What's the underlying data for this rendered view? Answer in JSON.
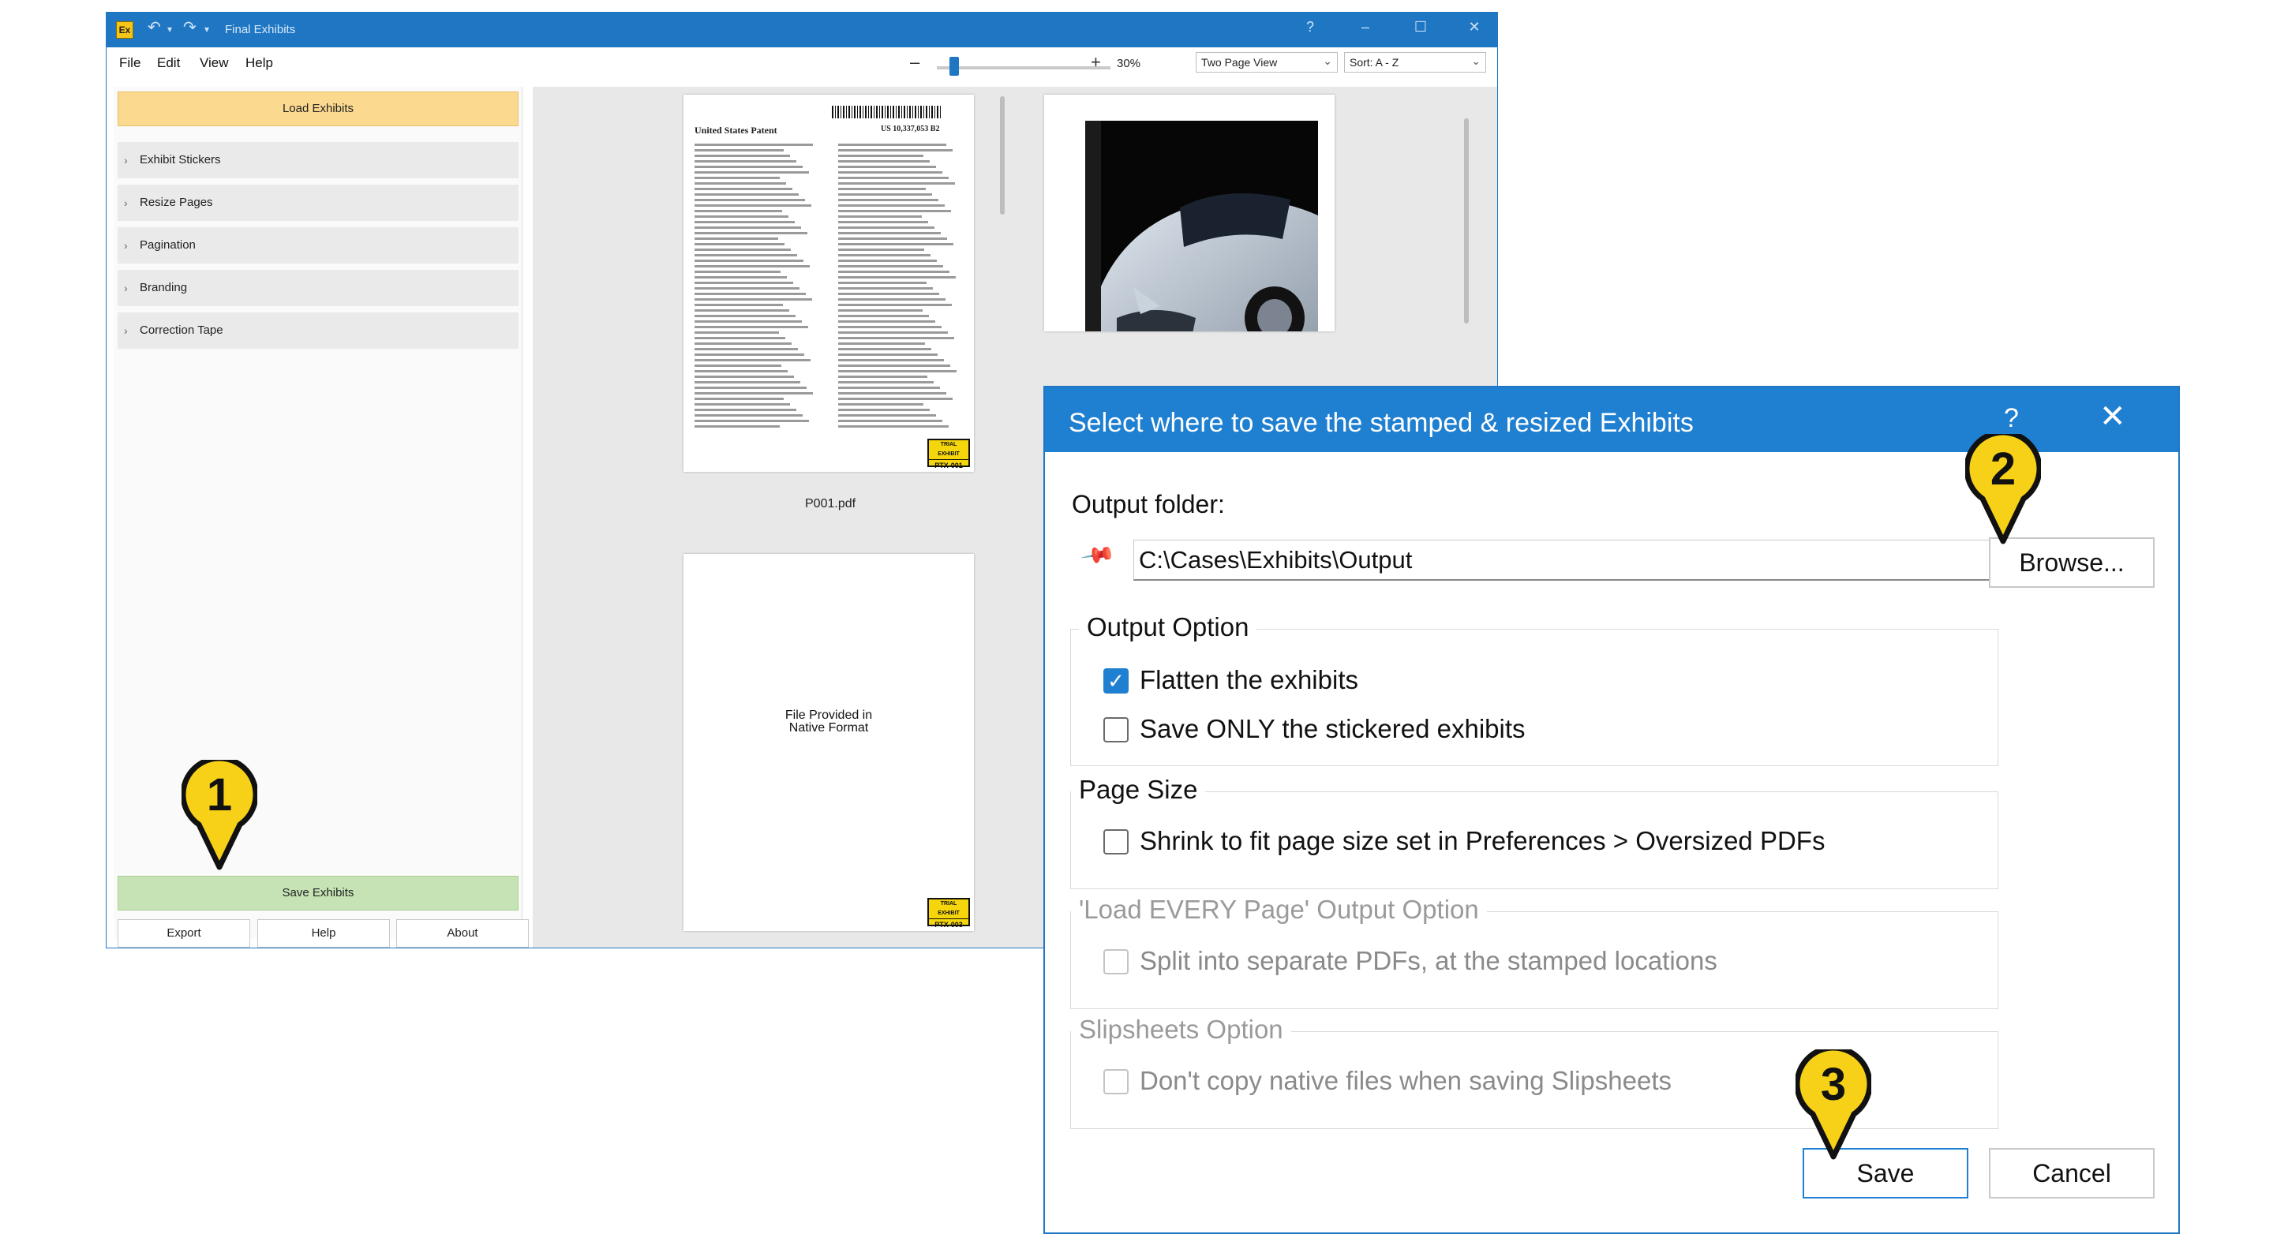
{
  "app": {
    "logo_text": "Ex",
    "undo_icon": "undo-icon",
    "redo_icon": "redo-icon",
    "title": "Final Exhibits",
    "help": "?",
    "minimize": "–",
    "maximize": "☐",
    "close": "✕",
    "menu": [
      "File",
      "Edit",
      "View",
      "Help"
    ],
    "zoom_minus": "–",
    "zoom_plus": "+",
    "zoom_value": "30%",
    "zoom_level_percent": 30,
    "view_mode": "Two Page View",
    "sort": "Sort: A - Z"
  },
  "left_panel": {
    "load_button": "Load Exhibits",
    "sections": [
      "Exhibit Stickers",
      "Resize Pages",
      "Pagination",
      "Branding",
      "Correction Tape"
    ],
    "save_button": "Save Exhibits",
    "export_button": "Export",
    "help_button": "Help",
    "about_button": "About"
  },
  "preview": {
    "page1_header": "United States Patent",
    "page1_number": "US 10,337,053 B2",
    "page1_sticker_top": "TRIAL EXHIBIT",
    "page1_sticker": "PTX-001",
    "page1_filename": "P001.pdf",
    "page2_text_1": "File Provided in",
    "page2_text_2": "Native Format",
    "page2_sticker_top": "TRIAL EXHIBIT",
    "page2_sticker": "PTX-003"
  },
  "dialog": {
    "title": "Select where to save the stamped & resized Exhibits",
    "help": "?",
    "close": "✕",
    "output_folder_label": "Output folder:",
    "output_folder_value": "C:\\Cases\\Exhibits\\Output",
    "browse_button": "Browse...",
    "output_option_title": "Output Option",
    "flatten_label": "Flatten the exhibits",
    "flatten_checked": true,
    "save_only_label": "Save ONLY the stickered exhibits",
    "save_only_checked": false,
    "page_size_title": "Page Size",
    "shrink_label": "Shrink to fit page size set in Preferences > Oversized PDFs",
    "shrink_checked": false,
    "load_every_title": "'Load EVERY Page' Output Option",
    "split_label": "Split into separate PDFs, at the stamped locations",
    "split_checked": false,
    "slipsheets_title": "Slipsheets Option",
    "native_label": "Don't copy native files when saving Slipsheets",
    "native_checked": false,
    "save_button": "Save",
    "cancel_button": "Cancel"
  },
  "callouts": [
    "1",
    "2",
    "3"
  ],
  "colors": {
    "accent": "#1f77c4",
    "load_button": "#fbd98e",
    "save_button": "#c5e3b4",
    "marker_fill": "#f7d117",
    "sticker": "#f5d50c"
  }
}
